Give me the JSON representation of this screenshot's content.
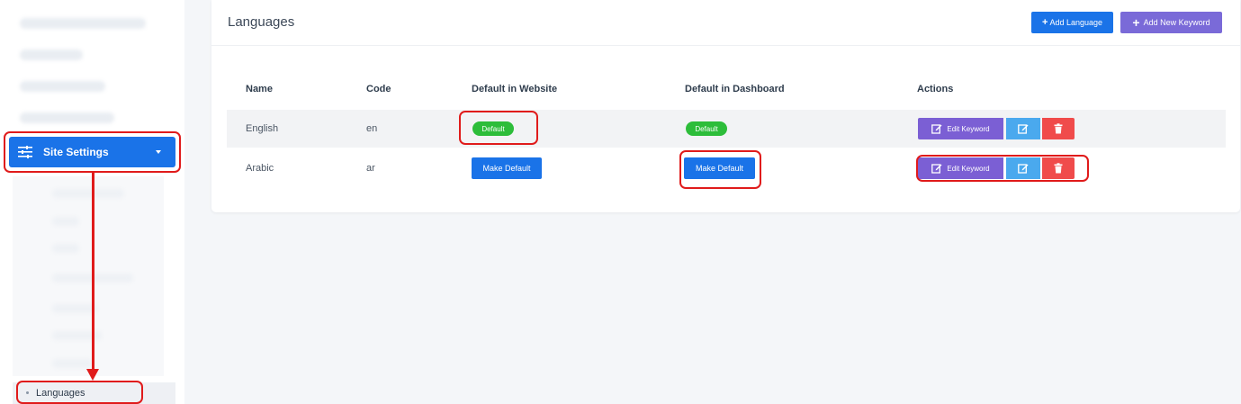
{
  "sidebar": {
    "active_section": "Site Settings",
    "active_item": "Languages"
  },
  "page": {
    "title": "Languages",
    "add_language_label": "Add Language",
    "add_keyword_label": "Add New Keyword"
  },
  "table": {
    "headers": [
      "Name",
      "Code",
      "Default in Website",
      "Default in Dashboard",
      "Actions"
    ],
    "rows": [
      {
        "name": "English",
        "code": "en",
        "website": "Default",
        "dashboard": "Default",
        "edit_keyword": "Edit Keyword"
      },
      {
        "name": "Arabic",
        "code": "ar",
        "website": "Make Default",
        "dashboard": "Make Default",
        "edit_keyword": "Edit Keyword"
      }
    ]
  },
  "colors": {
    "primary": "#1a73e8",
    "purple": "#7a6ad8",
    "success": "#2dbd3a",
    "info": "#4aa9ee",
    "danger": "#f04b4b",
    "annotation": "#e01b1b"
  },
  "icons": {
    "site_settings": "sliders-icon",
    "edit": "edit-icon",
    "delete": "trash-icon"
  }
}
